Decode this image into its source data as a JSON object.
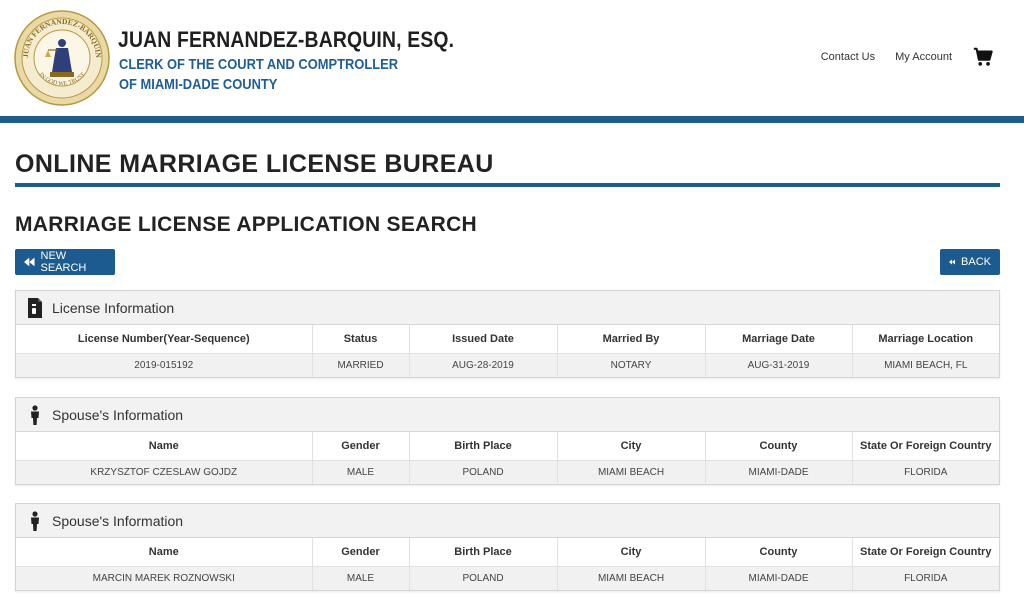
{
  "header": {
    "seal_text_top": "JUAN FERNANDEZ-BARQUIN",
    "seal_text_bottom": "IN GOD WE TRUST",
    "clerk_name": "JUAN FERNANDEZ-BARQUIN, ESQ.",
    "clerk_title_line1": "CLERK OF THE COURT AND COMPTROLLER",
    "clerk_title_line2": "OF MIAMI-DADE COUNTY",
    "nav": {
      "contact_us": "Contact Us",
      "my_account": "My Account",
      "cart_icon": "shopping-cart-icon"
    }
  },
  "page": {
    "bureau_title": "ONLINE MARRIAGE LICENSE BUREAU",
    "search_title": "MARRIAGE LICENSE APPLICATION SEARCH"
  },
  "buttons": {
    "new_search": "NEW SEARCH",
    "back": "BACK"
  },
  "license": {
    "title": "License Information",
    "icon": "document-icon",
    "columns": [
      "License Number(Year-Sequence)",
      "Status",
      "Issued Date",
      "Married By",
      "Marriage Date",
      "Marriage Location"
    ],
    "row": [
      "2019-015192",
      "MARRIED",
      "AUG-28-2019",
      "NOTARY",
      "AUG-31-2019",
      "MIAMI BEACH, FL"
    ]
  },
  "spouse1": {
    "title": "Spouse's Information",
    "icon": "person-icon",
    "columns": [
      "Name",
      "Gender",
      "Birth Place",
      "City",
      "County",
      "State Or Foreign Country"
    ],
    "row": [
      "KRZYSZTOF CZESLAW GOJDZ",
      "MALE",
      "POLAND",
      "MIAMI BEACH",
      "MIAMI-DADE",
      "FLORIDA"
    ]
  },
  "spouse2": {
    "title": "Spouse's Information",
    "icon": "person-icon",
    "columns": [
      "Name",
      "Gender",
      "Birth Place",
      "City",
      "County",
      "State Or Foreign Country"
    ],
    "row": [
      "MARCIN MAREK ROZNOWSKI",
      "MALE",
      "POLAND",
      "MIAMI BEACH",
      "MIAMI-DADE",
      "FLORIDA"
    ]
  },
  "colors": {
    "brand_blue": "#1f5d8c",
    "button_blue": "#1c5b8f",
    "title_blue": "#1f5d96",
    "seal_gold": "#c9a94e"
  }
}
